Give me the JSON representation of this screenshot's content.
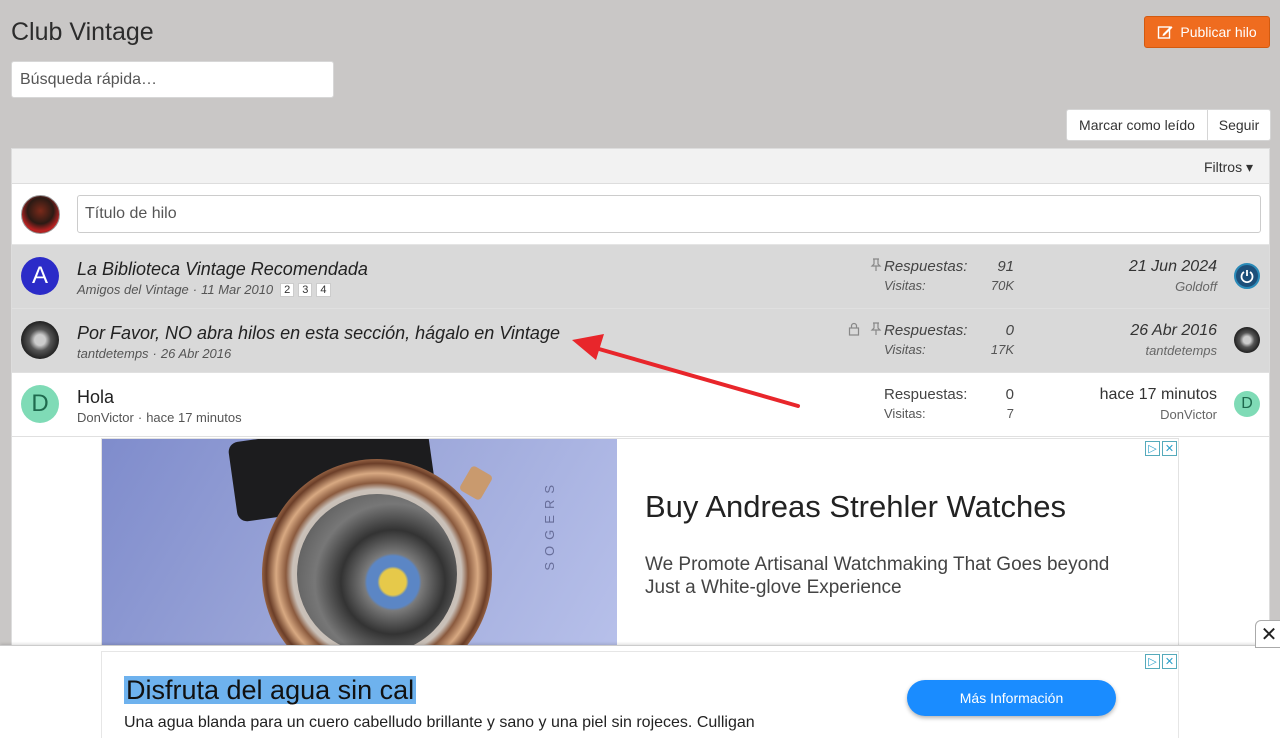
{
  "header": {
    "title": "Club Vintage",
    "publish_label": "Publicar hilo",
    "search_placeholder": "Búsqueda rápida…"
  },
  "actions": {
    "mark_read": "Marcar como leído",
    "follow": "Seguir",
    "filters": "Filtros ▾"
  },
  "new_thread": {
    "placeholder": "Título de hilo"
  },
  "threads": [
    {
      "title": "La Biblioteca Vintage Recomendada",
      "author": "Amigos del Vintage",
      "date": "11 Mar 2010",
      "pages": [
        "2",
        "3",
        "4"
      ],
      "replies_label": "Respuestas:",
      "replies": "91",
      "views_label": "Visitas:",
      "views": "70K",
      "last_date": "21 Jun 2024",
      "last_user": "Goldoff",
      "avatar_letter": "A",
      "avatar_color": "#2b2bc8"
    },
    {
      "title": "Por Favor, NO abra hilos en esta sección, hágalo en Vintage",
      "author": "tantdetemps",
      "date": "26 Abr 2016",
      "replies_label": "Respuestas:",
      "replies": "0",
      "views_label": "Visitas:",
      "views": "17K",
      "last_date": "26 Abr 2016",
      "last_user": "tantdetemps"
    },
    {
      "title": "Hola",
      "author": "DonVictor",
      "date": "hace 17 minutos",
      "replies_label": "Respuestas:",
      "replies": "0",
      "views_label": "Visitas:",
      "views": "7",
      "last_date": "hace 17 minutos",
      "last_user": "DonVictor",
      "avatar_letter": "D",
      "avatar_color": "#7fdbb6"
    }
  ],
  "ad_watch": {
    "title": "Buy Andreas Strehler Watches",
    "description": "We Promote Artisanal Watchmaking That Goes beyond Just a White-glove Experience",
    "photo_text": "SOGERS"
  },
  "ad_bottom": {
    "title": "Disfruta del agua sin cal",
    "description": "Una agua blanda para un cuero cabelludo brillante y sano y una piel sin rojeces. Culligan",
    "cta": "Más Información"
  },
  "colors": {
    "accent": "#ef6c1f",
    "sticky_bg": "#d9d9d9",
    "cta": "#1a8cff",
    "arrow": "#e8262b"
  }
}
